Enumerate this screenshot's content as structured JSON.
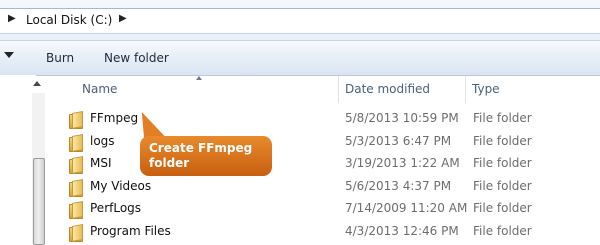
{
  "addressbar": {
    "location": "Local Disk (C:)"
  },
  "toolbar": {
    "burn_label": "Burn",
    "new_folder_label": "New folder"
  },
  "columns": {
    "name": "Name",
    "date": "Date modified",
    "type": "Type"
  },
  "files": [
    {
      "name": "FFmpeg",
      "date": "5/8/2013 10:59 PM",
      "type": "File folder"
    },
    {
      "name": "logs",
      "date": "5/3/2013 6:47 PM",
      "type": "File folder"
    },
    {
      "name": "MSI",
      "date": "3/19/2013 1:22 AM",
      "type": "File folder"
    },
    {
      "name": "My Videos",
      "date": "5/6/2013 4:37 PM",
      "type": "File folder"
    },
    {
      "name": "PerfLogs",
      "date": "7/14/2009 11:20 AM",
      "type": "File folder"
    },
    {
      "name": "Program Files",
      "date": "4/3/2013 12:46 PM",
      "type": "File folder"
    }
  ],
  "callout": {
    "line1": "Create FFmpeg",
    "line2": "folder",
    "color": "#d8701c"
  },
  "icons": {
    "folder": "folder-icon",
    "breadcrumb_separator": "chevron-right-icon",
    "organize_dropdown": "chevron-down-icon"
  }
}
